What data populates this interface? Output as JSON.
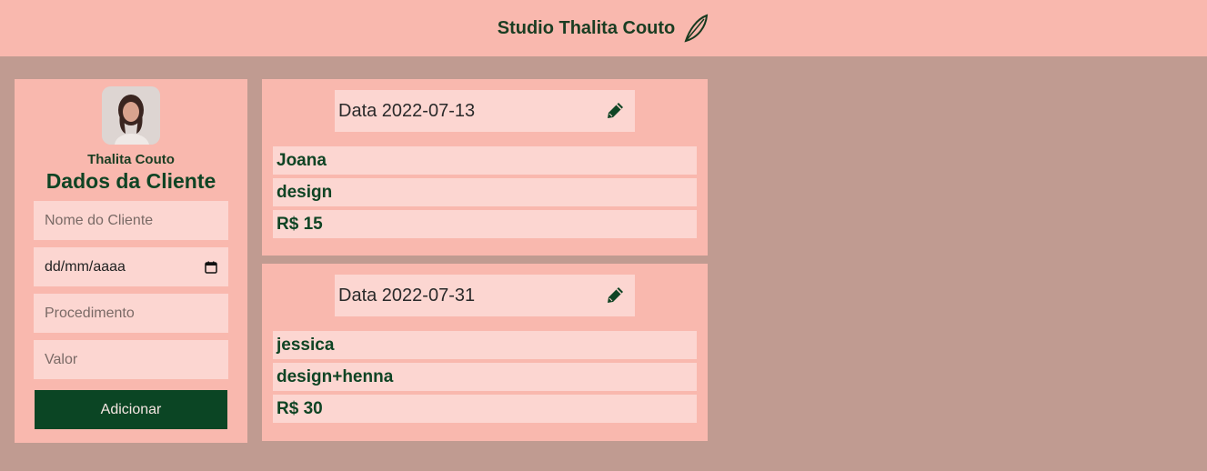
{
  "header": {
    "title": "Studio Thalita Couto",
    "icon": "leaf-icon"
  },
  "form": {
    "owner_name": "Thalita Couto",
    "title": "Dados da Cliente",
    "name_placeholder": "Nome do Cliente",
    "date_placeholder": "dd/mm/aaaa",
    "procedure_placeholder": "Procedimento",
    "value_placeholder": "Valor",
    "submit_label": "Adicionar"
  },
  "appointments": [
    {
      "date": "Data 2022-07-13",
      "client": "Joana",
      "procedure": "design",
      "price": "R$ 15"
    },
    {
      "date": "Data 2022-07-31",
      "client": "jessica",
      "procedure": "design+henna",
      "price": "R$ 30"
    }
  ],
  "colors": {
    "background": "#c09b91",
    "panel": "#f9b8ae",
    "field": "#fcd6d1",
    "accent": "#0b4524"
  }
}
